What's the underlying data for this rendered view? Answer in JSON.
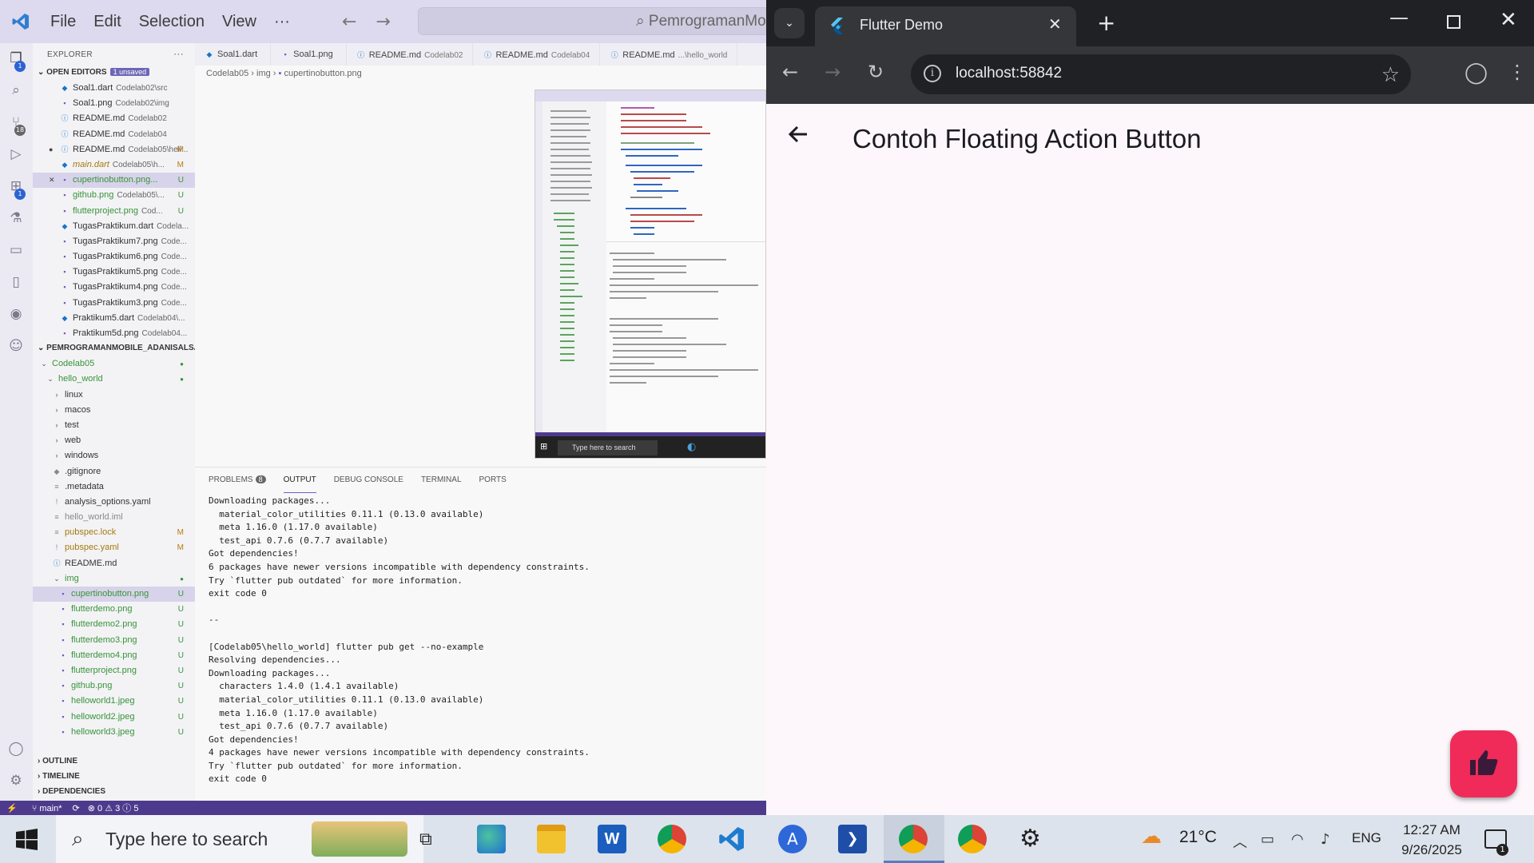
{
  "vscode": {
    "menu": [
      "File",
      "Edit",
      "Selection",
      "View",
      "···"
    ],
    "search_text": "PemrogramanMo",
    "explorer_label": "EXPLORER",
    "open_editors_label": "OPEN EDITORS",
    "unsaved_badge": "1 unsaved",
    "open_editors": [
      {
        "name": "Soal1.dart",
        "path": "Codelab02\\src",
        "type": "dart"
      },
      {
        "name": "Soal1.png",
        "path": "Codelab02\\img",
        "type": "png"
      },
      {
        "name": "README.md",
        "path": "Codelab02",
        "type": "info"
      },
      {
        "name": "README.md",
        "path": "Codelab04",
        "type": "info"
      },
      {
        "name": "README.md",
        "path": "Codelab05\\hell...",
        "type": "info",
        "status": "M",
        "dot": "●"
      },
      {
        "name": "main.dart",
        "path": "Codelab05\\h...",
        "type": "dart",
        "status": "M",
        "italic": true
      },
      {
        "name": "cupertinobutton.png...",
        "path": "",
        "type": "png",
        "status": "U",
        "selected": true,
        "close": "✕"
      },
      {
        "name": "github.png",
        "path": "Codelab05\\...",
        "type": "png",
        "status": "U"
      },
      {
        "name": "flutterproject.png",
        "path": "Cod...",
        "type": "png",
        "status": "U"
      },
      {
        "name": "TugasPraktikum.dart",
        "path": "Codela...",
        "type": "dart"
      },
      {
        "name": "TugasPraktikum7.png",
        "path": "Code...",
        "type": "png"
      },
      {
        "name": "TugasPraktikum6.png",
        "path": "Code...",
        "type": "png"
      },
      {
        "name": "TugasPraktikum5.png",
        "path": "Code...",
        "type": "png"
      },
      {
        "name": "TugasPraktikum4.png",
        "path": "Code...",
        "type": "png"
      },
      {
        "name": "TugasPraktikum3.png",
        "path": "Code...",
        "type": "png"
      },
      {
        "name": "Praktikum5.dart",
        "path": "Codelab04\\...",
        "type": "dart"
      },
      {
        "name": "Praktikum5d.png",
        "path": "Codelab04...",
        "type": "png"
      }
    ],
    "workspace_label": "PEMROGRAMANMOBILE_ADANISALSA...",
    "tree": [
      {
        "name": "Codelab05",
        "arrow": "⌄",
        "indent": 8,
        "color": "green",
        "dot": "●"
      },
      {
        "name": "hello_world",
        "arrow": "⌄",
        "indent": 16,
        "color": "green",
        "dot": "●"
      },
      {
        "name": "linux",
        "arrow": "›",
        "indent": 24
      },
      {
        "name": "macos",
        "arrow": "›",
        "indent": 24
      },
      {
        "name": "test",
        "arrow": "›",
        "indent": 24
      },
      {
        "name": "web",
        "arrow": "›",
        "indent": 24
      },
      {
        "name": "windows",
        "arrow": "›",
        "indent": 24
      },
      {
        "name": ".gitignore",
        "icon": "◆",
        "indent": 24
      },
      {
        "name": ".metadata",
        "icon": "≡",
        "indent": 24
      },
      {
        "name": "analysis_options.yaml",
        "icon": "!",
        "indent": 24
      },
      {
        "name": "hello_world.iml",
        "icon": "≡",
        "indent": 24,
        "color": "gray"
      },
      {
        "name": "pubspec.lock",
        "icon": "≡",
        "indent": 24,
        "color": "amber",
        "status": "M"
      },
      {
        "name": "pubspec.yaml",
        "icon": "!",
        "indent": 24,
        "color": "amber",
        "status": "M"
      },
      {
        "name": "README.md",
        "icon": "ⓘ",
        "indent": 24
      },
      {
        "name": "img",
        "arrow": "⌄",
        "indent": 24,
        "color": "green",
        "dot": "●"
      },
      {
        "name": "cupertinobutton.png",
        "icon": "▪",
        "indent": 32,
        "color": "green",
        "status": "U",
        "selected": true
      },
      {
        "name": "flutterdemo.png",
        "icon": "▪",
        "indent": 32,
        "color": "green",
        "status": "U"
      },
      {
        "name": "flutterdemo2.png",
        "icon": "▪",
        "indent": 32,
        "color": "green",
        "status": "U"
      },
      {
        "name": "flutterdemo3.png",
        "icon": "▪",
        "indent": 32,
        "color": "green",
        "status": "U"
      },
      {
        "name": "flutterdemo4.png",
        "icon": "▪",
        "indent": 32,
        "color": "green",
        "status": "U"
      },
      {
        "name": "flutterproject.png",
        "icon": "▪",
        "indent": 32,
        "color": "green",
        "status": "U"
      },
      {
        "name": "github.png",
        "icon": "▪",
        "indent": 32,
        "color": "green",
        "status": "U"
      },
      {
        "name": "helloworld1.jpeg",
        "icon": "▪",
        "indent": 32,
        "color": "green",
        "status": "U"
      },
      {
        "name": "helloworld2.jpeg",
        "icon": "▪",
        "indent": 32,
        "color": "green",
        "status": "U"
      },
      {
        "name": "helloworld3.jpeg",
        "icon": "▪",
        "indent": 32,
        "color": "green",
        "status": "U"
      }
    ],
    "outline_label": "OUTLINE",
    "timeline_label": "TIMELINE",
    "dependencies_label": "DEPENDENCIES",
    "tabs": [
      {
        "name": "Soal1.dart",
        "path": ""
      },
      {
        "name": "Soal1.png",
        "path": ""
      },
      {
        "name": "README.md",
        "path": "Codelab02"
      },
      {
        "name": "README.md",
        "path": "Codelab04"
      },
      {
        "name": "README.md",
        "path": "...\\hello_world"
      }
    ],
    "breadcrumb": [
      "Codelab05",
      "img",
      "cupertinobutton.png"
    ],
    "panel_tabs": [
      "PROBLEMS",
      "OUTPUT",
      "DEBUG CONSOLE",
      "TERMINAL",
      "PORTS"
    ],
    "problems_count": "8",
    "output": "Downloading packages...\n  material_color_utilities 0.11.1 (0.13.0 available)\n  meta 1.16.0 (1.17.0 available)\n  test_api 0.7.6 (0.7.7 available)\nGot dependencies!\n6 packages have newer versions incompatible with dependency constraints.\nTry `flutter pub outdated` for more information.\nexit code 0\n\n--\n\n[Codelab05\\hello_world] flutter pub get --no-example\nResolving dependencies...\nDownloading packages...\n  characters 1.4.0 (1.4.1 available)\n  material_color_utilities 0.11.1 (0.13.0 available)\n  meta 1.16.0 (1.17.0 available)\n  test_api 0.7.6 (0.7.7 available)\nGot dependencies!\n4 packages have newer versions incompatible with dependency constraints.\nTry `flutter pub outdated` for more information.\nexit code 0",
    "status_branch": "main*",
    "status_problems": "⊗ 0 ⚠ 3 ⓘ 5",
    "preview_search": "Type here to search"
  },
  "chrome": {
    "tab_title": "Flutter Demo",
    "url": "localhost:58842",
    "app_title": "Contoh Floating Action Button",
    "fab_color": "#f02b59"
  },
  "taskbar": {
    "search_placeholder": "Type here to search",
    "temperature": "21°C",
    "language": "ENG",
    "time": "12:27 AM",
    "date": "9/26/2025",
    "notification_count": "1",
    "apps": [
      "edge-icon",
      "file-explorer-icon",
      "word-icon",
      "chrome-profile-icon",
      "vscode-icon",
      "app-icon",
      "powershell-icon",
      "chrome-icon",
      "chrome-icon-2",
      "settings-icon"
    ]
  }
}
